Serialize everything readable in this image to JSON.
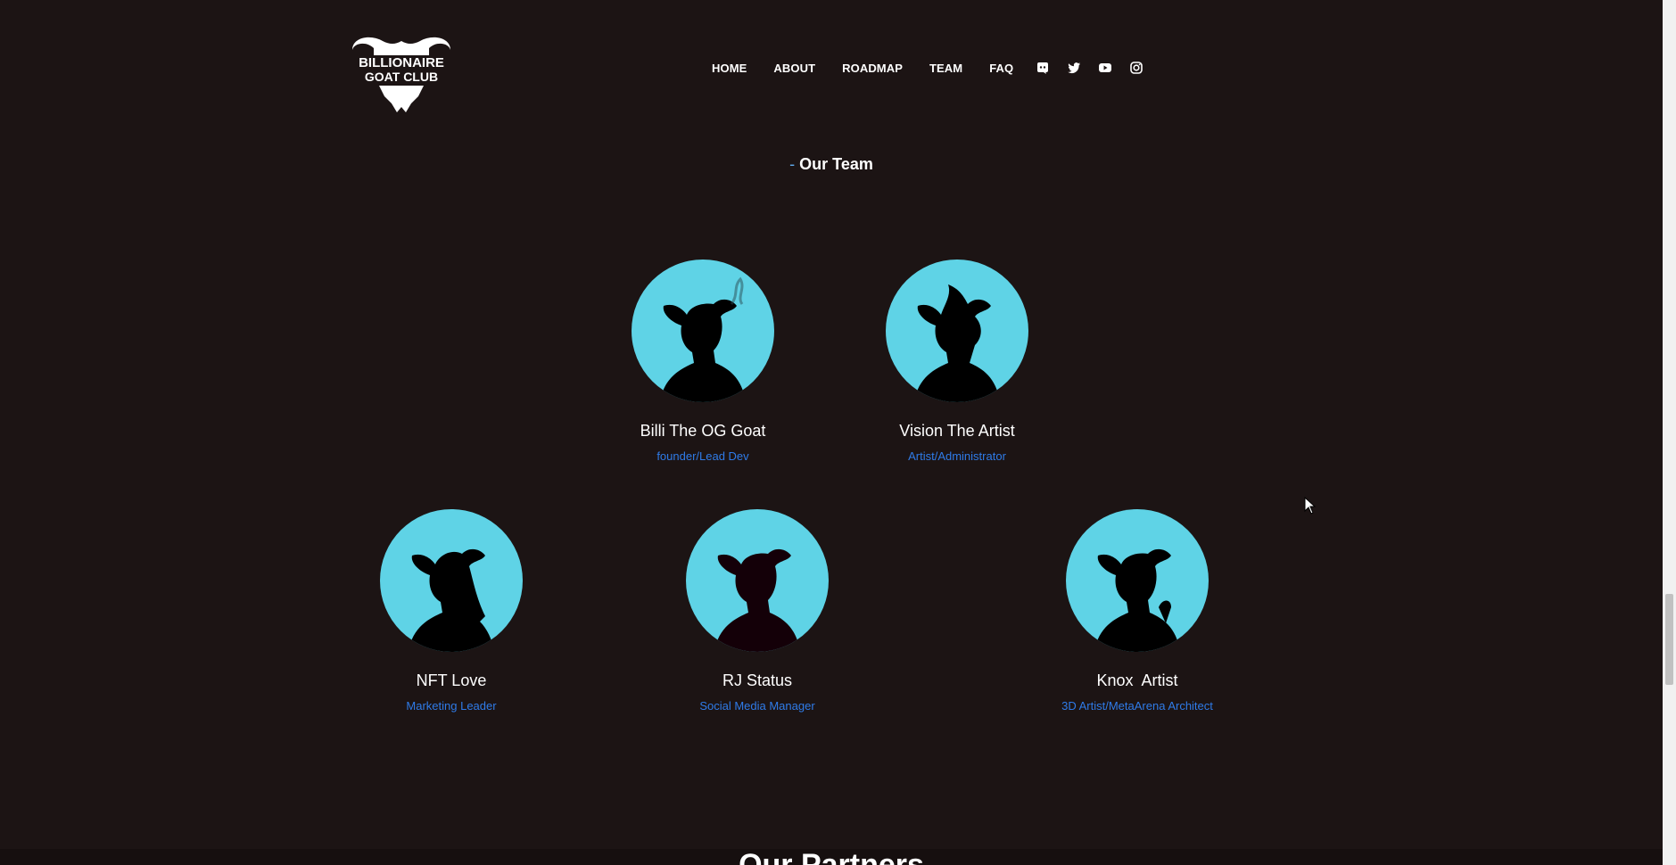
{
  "brand": {
    "logo_line1": "BILLIONAIRE",
    "logo_line2": "GOAT CLUB"
  },
  "nav": {
    "links": [
      "HOME",
      "ABOUT",
      "ROADMAP",
      "TEAM",
      "FAQ"
    ],
    "social_icons": [
      "discord-icon",
      "twitter-icon",
      "youtube-icon",
      "instagram-icon"
    ]
  },
  "team": {
    "dash": "-",
    "title": "Our Team",
    "members": [
      {
        "name": "Billi The OG Goat",
        "role": "founder/Lead Dev"
      },
      {
        "name": "Vision The Artist",
        "role": "Artist/Administrator"
      },
      {
        "name": "NFT Love",
        "role": "Marketing Leader"
      },
      {
        "name": "RJ Status",
        "role": "Social Media Manager"
      },
      {
        "name": "Knox  Artist",
        "role": "3D Artist/MetaArena Architect"
      }
    ]
  },
  "partners": {
    "title": "Our Partners"
  },
  "colors": {
    "background": "#1c1414",
    "avatar": "#5fd3e6",
    "role": "#2f7be8",
    "accent_dash": "#5fa8e8"
  }
}
